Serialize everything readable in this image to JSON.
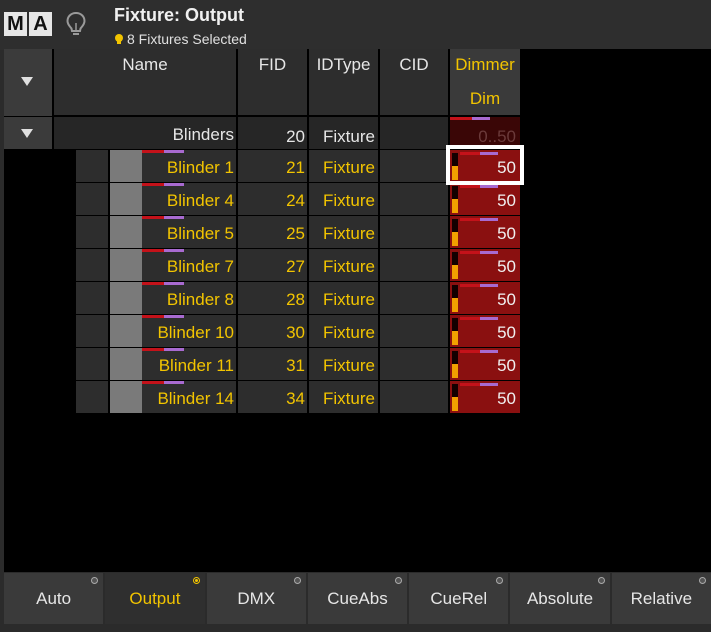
{
  "window": {
    "logo_letters": [
      "M",
      "A"
    ],
    "title": "Fixture: Output",
    "subtitle": "8 Fixtures Selected"
  },
  "columns": {
    "name": "Name",
    "fid": "FID",
    "idtype": "IDType",
    "cid": "CID",
    "dimmer": "Dimmer",
    "dimmer_sub": "Dim"
  },
  "group": {
    "name": "Blinders",
    "fid": "20",
    "idtype": "Fixture",
    "value": "0..50"
  },
  "rows": [
    {
      "name": "Blinder 1",
      "fid": "21",
      "idtype": "Fixture",
      "value": "50"
    },
    {
      "name": "Blinder 4",
      "fid": "24",
      "idtype": "Fixture",
      "value": "50"
    },
    {
      "name": "Blinder 5",
      "fid": "25",
      "idtype": "Fixture",
      "value": "50"
    },
    {
      "name": "Blinder 7",
      "fid": "27",
      "idtype": "Fixture",
      "value": "50"
    },
    {
      "name": "Blinder 8",
      "fid": "28",
      "idtype": "Fixture",
      "value": "50"
    },
    {
      "name": "Blinder 10",
      "fid": "30",
      "idtype": "Fixture",
      "value": "50"
    },
    {
      "name": "Blinder 11",
      "fid": "31",
      "idtype": "Fixture",
      "value": "50"
    },
    {
      "name": "Blinder 14",
      "fid": "34",
      "idtype": "Fixture",
      "value": "50"
    }
  ],
  "dimmer_level_fraction": 0.5,
  "tabs": [
    {
      "label": "Auto",
      "active": false
    },
    {
      "label": "Output",
      "active": true
    },
    {
      "label": "DMX",
      "active": false
    },
    {
      "label": "CueAbs",
      "active": false
    },
    {
      "label": "CueRel",
      "active": false
    },
    {
      "label": "Absolute",
      "active": false
    },
    {
      "label": "Relative",
      "active": false
    }
  ],
  "colors": {
    "accent_yellow": "#f2c400",
    "dimmer_red": "#8a1010",
    "marker_red": "#c4121a",
    "marker_purple": "#a86ad0",
    "meter_orange": "#f2a000"
  },
  "icons": [
    "lightbulb-icon",
    "sort-arrow-icon",
    "status-bulb-icon"
  ]
}
